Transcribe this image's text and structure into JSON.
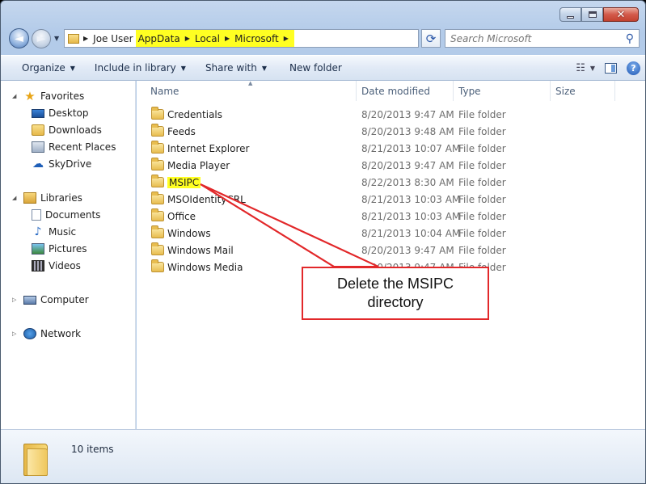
{
  "titlebar": {
    "close_label": "✕"
  },
  "address": {
    "crumbs": [
      {
        "label": "Joe User"
      },
      {
        "label": "AppData"
      },
      {
        "label": "Local"
      },
      {
        "label": "Microsoft"
      }
    ]
  },
  "search": {
    "placeholder": "Search Microsoft"
  },
  "toolbar": {
    "organize": "Organize",
    "include_in_library": "Include in library",
    "share_with": "Share with",
    "new_folder": "New folder"
  },
  "nav": {
    "favorites": "Favorites",
    "desktop": "Desktop",
    "downloads": "Downloads",
    "recent_places": "Recent Places",
    "skydrive": "SkyDrive",
    "libraries": "Libraries",
    "documents": "Documents",
    "music": "Music",
    "pictures": "Pictures",
    "videos": "Videos",
    "computer": "Computer",
    "network": "Network"
  },
  "columns": {
    "name": "Name",
    "date_modified": "Date modified",
    "type": "Type",
    "size": "Size"
  },
  "files": [
    {
      "name": "Credentials",
      "date": "8/20/2013 9:47 AM",
      "type": "File folder"
    },
    {
      "name": "Feeds",
      "date": "8/20/2013 9:48 AM",
      "type": "File folder"
    },
    {
      "name": "Internet Explorer",
      "date": "8/21/2013 10:07 AM",
      "type": "File folder"
    },
    {
      "name": "Media Player",
      "date": "8/20/2013 9:47 AM",
      "type": "File folder"
    },
    {
      "name": "MSIPC",
      "date": "8/22/2013 8:30 AM",
      "type": "File folder"
    },
    {
      "name": "MSOIdentityCRL",
      "date": "8/21/2013 10:03 AM",
      "type": "File folder"
    },
    {
      "name": "Office",
      "date": "8/21/2013 10:03 AM",
      "type": "File folder"
    },
    {
      "name": "Windows",
      "date": "8/21/2013 10:04 AM",
      "type": "File folder"
    },
    {
      "name": "Windows Mail",
      "date": "8/20/2013 9:47 AM",
      "type": "File folder"
    },
    {
      "name": "Windows Media",
      "date": "8/20/2013 9:47 AM",
      "type": "File folder"
    }
  ],
  "annotation": {
    "line1": "Delete the MSIPC",
    "line2": "directory",
    "color": "#e2282a",
    "highlight_color": "#ffff22"
  },
  "status": {
    "item_count": "10 items"
  }
}
